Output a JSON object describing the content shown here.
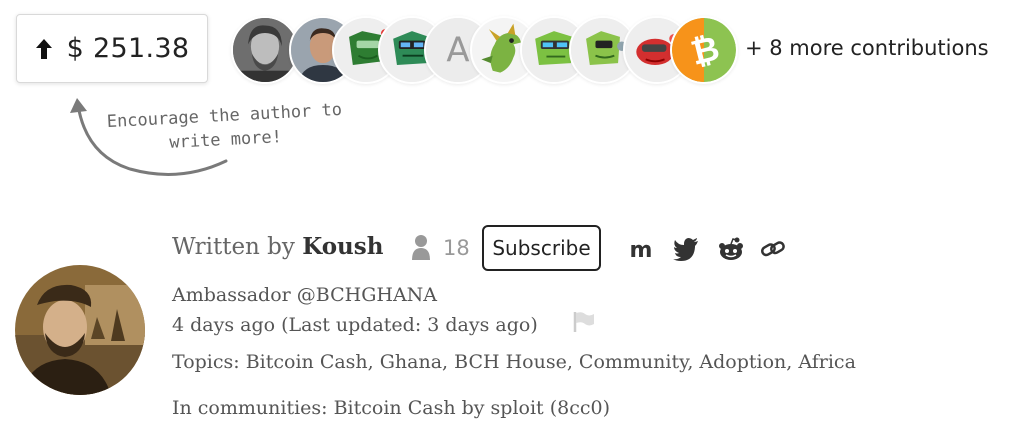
{
  "tip": {
    "amount": "$ 251.38",
    "arrow_icon": "arrow-up-icon"
  },
  "contributors": {
    "avatars": [
      {
        "name": "contributor-1",
        "kind": "photo"
      },
      {
        "name": "contributor-2",
        "kind": "photo"
      },
      {
        "name": "contributor-3",
        "kind": "green-robot"
      },
      {
        "name": "contributor-4",
        "kind": "green-robot"
      },
      {
        "name": "contributor-5",
        "kind": "letter",
        "letter": "A"
      },
      {
        "name": "contributor-6",
        "kind": "dragon"
      },
      {
        "name": "contributor-7",
        "kind": "green-robot"
      },
      {
        "name": "contributor-8",
        "kind": "green-robot"
      },
      {
        "name": "contributor-9",
        "kind": "red-robot"
      },
      {
        "name": "contributor-10",
        "kind": "bch-logo"
      }
    ],
    "more_text": "+ 8 more contributions"
  },
  "hint": {
    "text_line1": "Encourage the author to",
    "text_line2": "write more!"
  },
  "author": {
    "written_by": "Written by",
    "name": "Koush",
    "subscriber_count": "18",
    "subscribe_label": "Subscribe",
    "bio": "Ambassador @BCHGHANA",
    "timestamp": "4 days ago (Last updated: 3 days ago)",
    "topics": "Topics: Bitcoin Cash, Ghana, BCH House, Community, Adoption, Africa",
    "communities": "In communities: Bitcoin Cash by sploit (8cc0)"
  },
  "share_icons": [
    "medium-icon",
    "twitter-icon",
    "reddit-icon",
    "link-icon"
  ],
  "colors": {
    "accent_green": "#4caf50",
    "bch_orange": "#f7931a",
    "bch_green": "#8dc351",
    "text_dark": "#222222",
    "text_muted": "#999999"
  }
}
